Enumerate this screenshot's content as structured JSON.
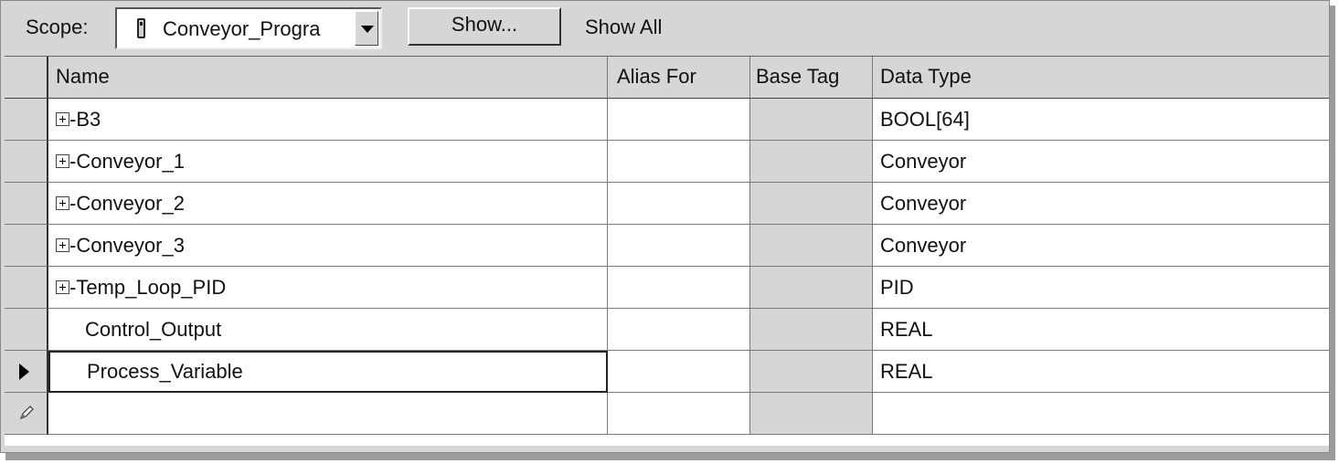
{
  "toolbar": {
    "scope_label": "Scope:",
    "scope_value": "Conveyor_Progra",
    "show_button": "Show...",
    "show_filter": "Show All"
  },
  "table": {
    "columns": [
      "Name",
      "Alias For",
      "Base Tag",
      "Data Type"
    ],
    "rows": [
      {
        "name": "-B3",
        "expandable": true,
        "alias_for": "",
        "base_tag": "",
        "data_type": "BOOL[64]"
      },
      {
        "name": "-Conveyor_1",
        "expandable": true,
        "alias_for": "",
        "base_tag": "",
        "data_type": "Conveyor"
      },
      {
        "name": "-Conveyor_2",
        "expandable": true,
        "alias_for": "",
        "base_tag": "",
        "data_type": "Conveyor"
      },
      {
        "name": "-Conveyor_3",
        "expandable": true,
        "alias_for": "",
        "base_tag": "",
        "data_type": "Conveyor"
      },
      {
        "name": "-Temp_Loop_PID",
        "expandable": true,
        "alias_for": "",
        "base_tag": "",
        "data_type": "PID"
      },
      {
        "name": "Control_Output",
        "expandable": false,
        "alias_for": "",
        "base_tag": "",
        "data_type": "REAL"
      },
      {
        "name": "Process_Variable",
        "expandable": false,
        "alias_for": "",
        "base_tag": "",
        "data_type": "REAL",
        "current": true
      },
      {
        "name": "",
        "expandable": false,
        "alias_for": "",
        "base_tag": "",
        "data_type": "",
        "new_row": true
      }
    ]
  },
  "icons": {
    "scope_icon": "program-icon",
    "dropdown": "chevron-down-icon",
    "expander": "plus-box-icon",
    "current_row": "row-pointer-icon",
    "new_row": "pencil-icon"
  }
}
